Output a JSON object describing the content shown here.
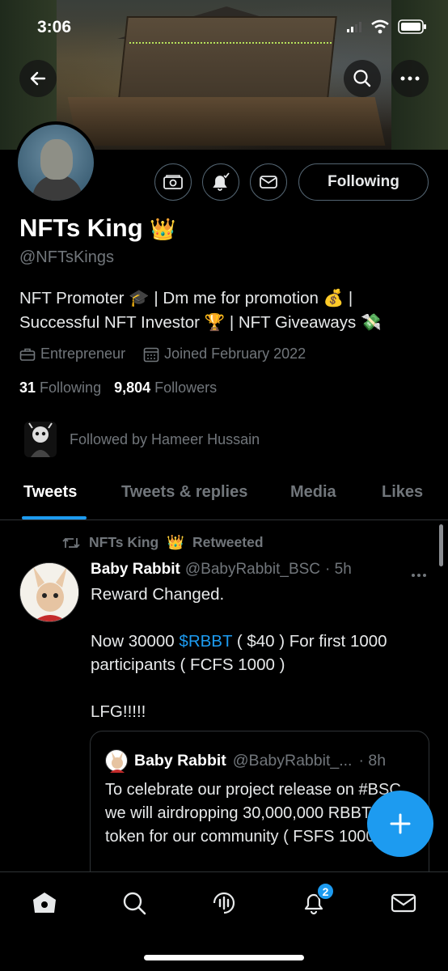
{
  "status_bar": {
    "time": "3:06"
  },
  "profile": {
    "name": "NFTs King",
    "name_emoji": "👑",
    "handle": "@NFTsKings",
    "bio": "NFT Promoter 🎓 | Dm me for promotion 💰 | Successful NFT Investor 🏆 | NFT Giveaways 💸",
    "category": "Entrepreneur",
    "joined": "Joined February 2022",
    "following_count": "31",
    "following_label": "Following",
    "followers_count": "9,804",
    "followers_label": "Followers",
    "followed_by": "Followed by Hameer Hussain",
    "follow_button_label": "Following"
  },
  "tabs": [
    {
      "label": "Tweets",
      "active": true
    },
    {
      "label": "Tweets & replies",
      "active": false
    },
    {
      "label": "Media",
      "active": false
    },
    {
      "label": "Likes",
      "active": false
    }
  ],
  "tweet": {
    "retweeted_by": "NFTs King",
    "retweeted_emoji": "👑",
    "retweeted_label": "Retweeted",
    "display_name": "Baby Rabbit",
    "handle": "@BabyRabbit_BSC",
    "time": "· 5h",
    "body_before": "Reward Changed.\n\nNow 30000 ",
    "cashtag": "$RBBT",
    "body_after": " ( $40 ) For first 1000 participants ( FCFS 1000 )\n\nLFG!!!!!",
    "quote": {
      "display_name": "Baby Rabbit",
      "handle": "@BabyRabbit_...",
      "time": "· 8h",
      "text": "To celebrate our project release on #BSC we will airdropping 30,000,000 RBBT token for our community ( FSFS 10000 )"
    }
  },
  "bottom_nav": {
    "notification_badge": "2"
  },
  "colors": {
    "accent": "#1d9bf0",
    "background": "#000000",
    "muted": "#71767b"
  }
}
